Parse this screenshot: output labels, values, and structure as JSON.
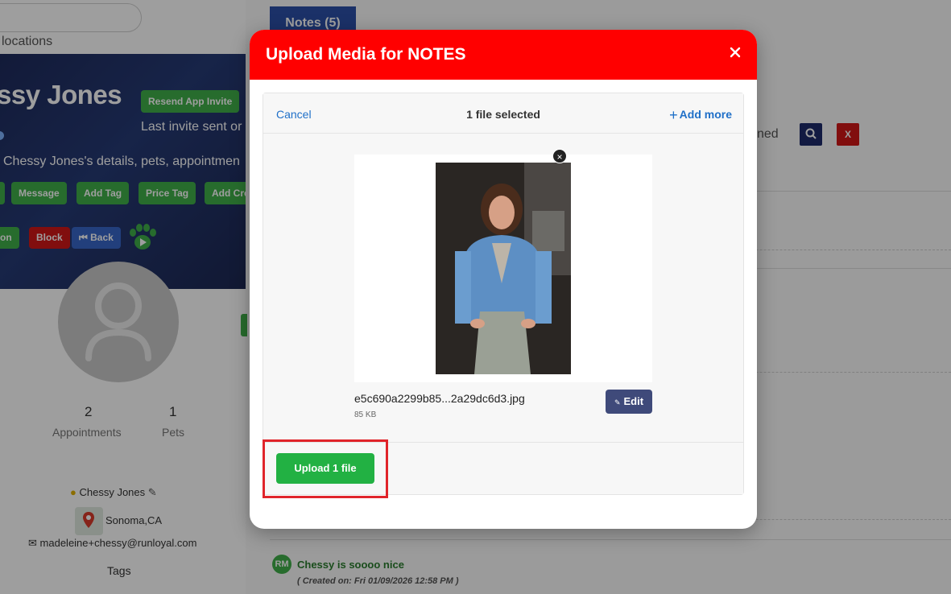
{
  "background": {
    "locations_text": "locations",
    "client_name": "ssy Jones",
    "resend_button": "Resend App Invite",
    "last_invite": "Last invite sent or",
    "description": "Chessy Jones's details, pets, appointmen",
    "action_buttons": [
      "",
      "Message",
      "Add Tag",
      "Price Tag",
      "Add Cre"
    ],
    "secondary_buttons": {
      "left": "on",
      "block": "Block",
      "back": "Back"
    },
    "stats": [
      {
        "value": "2",
        "label": "Appointments"
      },
      {
        "value": "1",
        "label": "Pets"
      }
    ],
    "owner_name": "Chessy Jones",
    "location": "Sonoma,CA",
    "email": "madeleine+chessy@runloyal.com",
    "tags_label": "Tags",
    "notes_tab": "Notes (5)",
    "partial_text": "ned",
    "search_btn_icon": "search-icon",
    "close_btn_label": "X",
    "note": {
      "avatar": "RM",
      "text": "Chessy is soooo nice",
      "created": "( Created on: Fri 01/09/2026 12:58 PM )"
    }
  },
  "modal": {
    "title": "Upload Media for NOTES",
    "close_icon": "close-icon",
    "cancel_label": "Cancel",
    "selected_text": "1 file selected",
    "add_more_label": "Add more",
    "file": {
      "name": "e5c690a2299b85...2a29dc6d3.jpg",
      "size": "85 KB",
      "edit_label": "Edit"
    },
    "upload_label": "Upload 1 file"
  },
  "colors": {
    "header_red": "#ff0000",
    "upload_green": "#22b143",
    "link_blue": "#2070c8",
    "edit_navy": "#3f4a7a",
    "highlight": "#e0242a"
  }
}
